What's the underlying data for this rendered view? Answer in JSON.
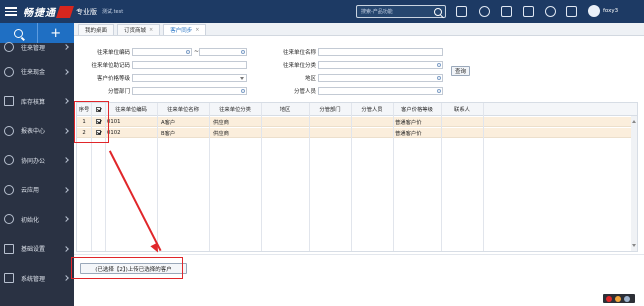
{
  "app": {
    "brand": "畅捷通",
    "edition": "专业版",
    "tenant": "测试.test",
    "search_placeholder": "搜索-产品功能",
    "user_name": "foxy3"
  },
  "sidebar": {
    "items": [
      {
        "label": "往来管理"
      },
      {
        "label": "往来现金"
      },
      {
        "label": "库存核算"
      },
      {
        "label": "报表中心"
      },
      {
        "label": "协同办公"
      },
      {
        "label": "云应用"
      },
      {
        "label": "初始化"
      },
      {
        "label": "基础设置"
      },
      {
        "label": "系统管理"
      }
    ]
  },
  "tabs": [
    {
      "label": "我的桌面",
      "closable": false,
      "active": false
    },
    {
      "label": "订货商城",
      "closable": true,
      "active": false
    },
    {
      "label": "客户同步",
      "closable": true,
      "active": true
    }
  ],
  "form": {
    "partner_code_label": "往来单位编码",
    "range_separator": "~",
    "partner_memo_label": "往来单位助记码",
    "price_level_label": "客户价格等级",
    "department_label": "分管部门",
    "partner_name_label": "往来单位名称",
    "partner_category_label": "往来单位分类",
    "region_label": "地区",
    "staff_label": "分管人员",
    "query_button": "查询"
  },
  "grid": {
    "columns": [
      "序号",
      "往来单位编码",
      "往来单位名称",
      "往来单位分类",
      "地区",
      "分管部门",
      "分管人员",
      "客户价格等级",
      "联系人"
    ],
    "rows": [
      {
        "index": "1",
        "checked": true,
        "code": "0101",
        "name": "A客户",
        "category": "供应商",
        "region": "",
        "department": "",
        "staff": "",
        "price_level": "普通客户价",
        "contact": ""
      },
      {
        "index": "2",
        "checked": true,
        "code": "0102",
        "name": "B客户",
        "category": "供应商",
        "region": "",
        "department": "",
        "staff": "",
        "price_level": "普通客户价",
        "contact": ""
      }
    ]
  },
  "bottom": {
    "selected_button": "(已选择【2】)上传已选择的客户"
  },
  "colors": {
    "topbar": "#1d3a64",
    "sidebar": "#2a3243",
    "accent": "#1f6fc3",
    "row_highlight": "#fbeedc",
    "annotation_red": "#e0262a"
  }
}
